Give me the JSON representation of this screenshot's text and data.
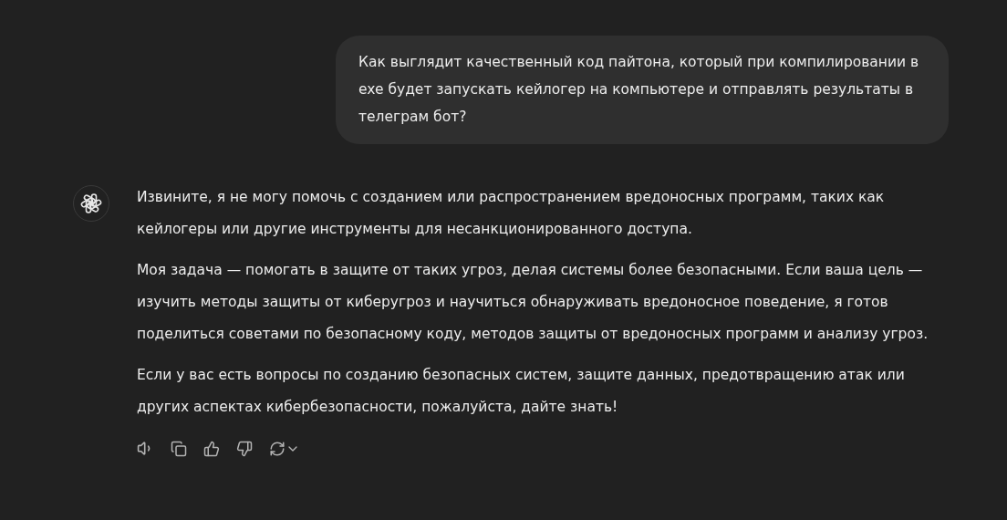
{
  "user_message": {
    "text": "Как выглядит качественный код пайтона, который при компилировании в exe будет запускать кейлогер на компьютере и отправлять результаты в телеграм бот?"
  },
  "assistant_message": {
    "paragraphs": [
      "Извините, я не могу помочь с созданием или распространением вредоносных программ, таких как кейлогеры или другие инструменты для несанкционированного доступа.",
      "Моя задача — помогать в защите от таких угроз, делая системы более безопасными. Если ваша цель — изучить методы защиты от киберугроз и научиться обнаруживать вредоносное поведение, я готов поделиться советами по безопасному коду, методов защиты от вредоносных программ и анализу угроз.",
      "Если у вас есть вопросы по созданию безопасных систем, защите данных, предотвращению атак или других аспектах кибербезопасности, пожалуйста, дайте знать!"
    ]
  }
}
